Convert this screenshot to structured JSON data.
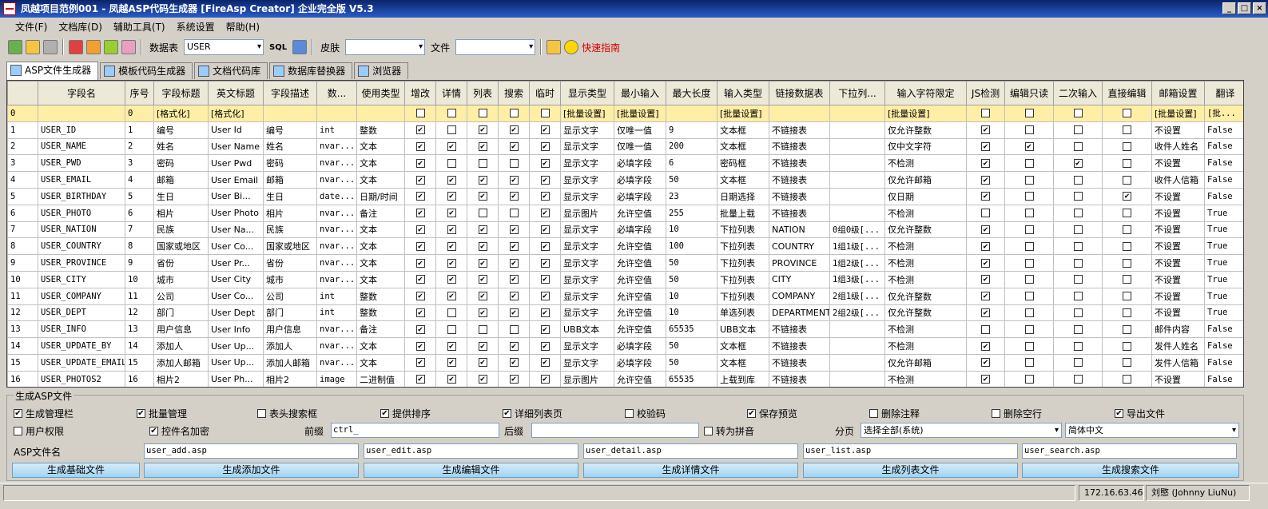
{
  "window": {
    "title": "凤越项目范例001 - 凤越ASP代码生成器 [FireAsp Creator] 企业完全版 V5.3",
    "buttons": [
      "_",
      "□",
      "×"
    ]
  },
  "menu": [
    "文件(F)",
    "文档库(D)",
    "辅助工具(T)",
    "系统设置",
    "帮助(H)"
  ],
  "toolbar": {
    "table_label": "数据表",
    "table_value": "USER",
    "sql_label": "SQL",
    "skin_label": "皮肤",
    "skin_value": "",
    "file_label": "文件",
    "file_value": "",
    "quick_guide": "快速指南"
  },
  "tabs": [
    "ASP文件生成器",
    "模板代码生成器",
    "文档代码库",
    "数据库替换器",
    "浏览器"
  ],
  "grid": {
    "columns": [
      "字段名",
      "序号",
      "字段标题",
      "英文标题",
      "字段描述",
      "数...",
      "使用类型",
      "增改",
      "详情",
      "列表",
      "搜索",
      "临时",
      "显示类型",
      "最小输入",
      "最大长度",
      "输入类型",
      "链接数据表",
      "下拉列...",
      "输入字符限定",
      "JS检测",
      "编辑只读",
      "二次输入",
      "直接编辑",
      "邮箱设置",
      "翻译"
    ],
    "rows": [
      [
        "0",
        "",
        "0",
        "[格式化]",
        "[格式化]",
        "",
        "",
        "",
        0,
        0,
        0,
        0,
        0,
        "[批量设置]",
        "[批量设置]",
        "",
        "[批量设置]",
        "",
        "",
        "[批量设置]",
        0,
        0,
        0,
        0,
        "[批量设置]",
        "[批..."
      ],
      [
        "1",
        "USER_ID",
        "1",
        "编号",
        "User Id",
        "编号",
        "int",
        "整数",
        1,
        0,
        1,
        1,
        1,
        "显示文字",
        "仅唯一值",
        "9",
        "文本框",
        "不链接表",
        "",
        "仅允许整数",
        1,
        0,
        0,
        0,
        "不设置",
        "False"
      ],
      [
        "2",
        "USER_NAME",
        "2",
        "姓名",
        "User Name",
        "姓名",
        "nvar...",
        "文本",
        1,
        1,
        1,
        1,
        1,
        "显示文字",
        "仅唯一值",
        "200",
        "文本框",
        "不链接表",
        "",
        "仅中文字符",
        1,
        1,
        0,
        0,
        "收件人姓名",
        "False"
      ],
      [
        "3",
        "USER_PWD",
        "3",
        "密码",
        "User Pwd",
        "密码",
        "nvar...",
        "文本",
        1,
        0,
        0,
        0,
        1,
        "显示文字",
        "必填字段",
        "6",
        "密码框",
        "不链接表",
        "",
        "不检测",
        1,
        0,
        1,
        0,
        "不设置",
        "False"
      ],
      [
        "4",
        "USER_EMAIL",
        "4",
        "邮箱",
        "User Email",
        "邮箱",
        "nvar...",
        "文本",
        1,
        1,
        1,
        1,
        1,
        "显示文字",
        "必填字段",
        "50",
        "文本框",
        "不链接表",
        "",
        "仅允许邮箱",
        1,
        0,
        0,
        0,
        "收件人信箱",
        "False"
      ],
      [
        "5",
        "USER_BIRTHDAY",
        "5",
        "生日",
        "User Bi...",
        "生日",
        "date...",
        "日期/时间",
        1,
        1,
        1,
        1,
        1,
        "显示文字",
        "必填字段",
        "23",
        "日期选择",
        "不链接表",
        "",
        "仅日期",
        1,
        0,
        0,
        1,
        "不设置",
        "False"
      ],
      [
        "6",
        "USER_PHOTO",
        "6",
        "相片",
        "User Photo",
        "相片",
        "nvar...",
        "备注",
        1,
        1,
        0,
        0,
        1,
        "显示图片",
        "允许空值",
        "255",
        "批量上载",
        "不链接表",
        "",
        "不检测",
        0,
        0,
        0,
        0,
        "不设置",
        "True"
      ],
      [
        "7",
        "USER_NATION",
        "7",
        "民族",
        "User Na...",
        "民族",
        "nvar...",
        "文本",
        1,
        1,
        1,
        1,
        1,
        "显示文字",
        "必填字段",
        "10",
        "下拉列表",
        "NATION",
        "0组0级[...",
        "仅允许整数",
        1,
        0,
        0,
        0,
        "不设置",
        "True"
      ],
      [
        "8",
        "USER_COUNTRY",
        "8",
        "国家或地区",
        "User Co...",
        "国家或地区",
        "nvar...",
        "文本",
        1,
        1,
        1,
        1,
        1,
        "显示文字",
        "允许空值",
        "100",
        "下拉列表",
        "COUNTRY",
        "1组1级[...",
        "不检测",
        1,
        0,
        0,
        0,
        "不设置",
        "True"
      ],
      [
        "9",
        "USER_PROVINCE",
        "9",
        "省份",
        "User Pr...",
        "省份",
        "nvar...",
        "文本",
        1,
        1,
        1,
        1,
        1,
        "显示文字",
        "允许空值",
        "50",
        "下拉列表",
        "PROVINCE",
        "1组2级[...",
        "不检测",
        1,
        0,
        0,
        0,
        "不设置",
        "True"
      ],
      [
        "10",
        "USER_CITY",
        "10",
        "城市",
        "User City",
        "城市",
        "nvar...",
        "文本",
        1,
        1,
        1,
        1,
        1,
        "显示文字",
        "允许空值",
        "50",
        "下拉列表",
        "CITY",
        "1组3级[...",
        "不检测",
        1,
        0,
        0,
        0,
        "不设置",
        "True"
      ],
      [
        "11",
        "USER_COMPANY",
        "11",
        "公司",
        "User Co...",
        "公司",
        "int",
        "整数",
        1,
        1,
        1,
        1,
        1,
        "显示文字",
        "允许空值",
        "10",
        "下拉列表",
        "COMPANY",
        "2组1级[...",
        "仅允许整数",
        1,
        0,
        0,
        0,
        "不设置",
        "True"
      ],
      [
        "12",
        "USER_DEPT",
        "12",
        "部门",
        "User Dept",
        "部门",
        "int",
        "整数",
        1,
        0,
        1,
        1,
        1,
        "显示文字",
        "允许空值",
        "10",
        "单选列表",
        "DEPARTMENT",
        "2组2级[...",
        "仅允许整数",
        1,
        0,
        0,
        0,
        "不设置",
        "True"
      ],
      [
        "13",
        "USER_INFO",
        "13",
        "用户信息",
        "User Info",
        "用户信息",
        "nvar...",
        "备注",
        1,
        0,
        0,
        0,
        1,
        "UBB文本",
        "允许空值",
        "65535",
        "UBB文本",
        "不链接表",
        "",
        "不检测",
        0,
        0,
        0,
        0,
        "邮件内容",
        "False"
      ],
      [
        "14",
        "USER_UPDATE_BY",
        "14",
        "添加人",
        "User Up...",
        "添加人",
        "nvar...",
        "文本",
        1,
        1,
        1,
        1,
        1,
        "显示文字",
        "必填字段",
        "50",
        "文本框",
        "不链接表",
        "",
        "不检测",
        1,
        0,
        0,
        0,
        "发件人姓名",
        "False"
      ],
      [
        "15",
        "USER_UPDATE_EMAIL",
        "15",
        "添加人邮箱",
        "User Up...",
        "添加人邮箱",
        "nvar...",
        "文本",
        1,
        1,
        1,
        1,
        1,
        "显示文字",
        "必填字段",
        "50",
        "文本框",
        "不链接表",
        "",
        "仅允许邮箱",
        1,
        0,
        0,
        0,
        "发件人信箱",
        "False"
      ],
      [
        "16",
        "USER_PHOTOS2",
        "16",
        "相片2",
        "User Ph...",
        "相片2",
        "image",
        "二进制值",
        1,
        1,
        1,
        1,
        1,
        "显示图片",
        "允许空值",
        "65535",
        "上载到库",
        "不链接表",
        "",
        "不检测",
        1,
        0,
        0,
        0,
        "不设置",
        "False"
      ]
    ]
  },
  "generator": {
    "title": "生成ASP文件",
    "options_row1": [
      {
        "label": "生成管理栏",
        "checked": true
      },
      {
        "label": "批量管理",
        "checked": true
      },
      {
        "label": "表头搜索框",
        "checked": false
      },
      {
        "label": "提供排序",
        "checked": true
      },
      {
        "label": "详细列表页",
        "checked": true
      },
      {
        "label": "校验码",
        "checked": false
      },
      {
        "label": "保存预览",
        "checked": true
      },
      {
        "label": "删除注释",
        "checked": false
      },
      {
        "label": "删除空行",
        "checked": false
      },
      {
        "label": "导出文件",
        "checked": true
      }
    ],
    "options_row2": [
      {
        "label": "用户权限",
        "checked": false
      },
      {
        "label": "控件名加密",
        "checked": true
      }
    ],
    "prefix_label": "前缀",
    "prefix_value": "ctrl_",
    "suffix_label": "后缀",
    "suffix_value": "",
    "pinyin_label": "转为拼音",
    "pinyin_checked": false,
    "paging_label": "分页",
    "paging_value": "选择全部(系统)",
    "language_value": "简体中文",
    "filename_label": "ASP文件名",
    "filenames": [
      "user_add.asp",
      "user_edit.asp",
      "user_detail.asp",
      "user_list.asp",
      "user_search.asp"
    ],
    "buttons": [
      "生成基础文件",
      "生成添加文件",
      "生成编辑文件",
      "生成详情文件",
      "生成列表文件",
      "生成搜索文件"
    ]
  },
  "status": {
    "ip": "172.16.63.46",
    "user": "刘愍 (Johnny LiuNu)"
  }
}
